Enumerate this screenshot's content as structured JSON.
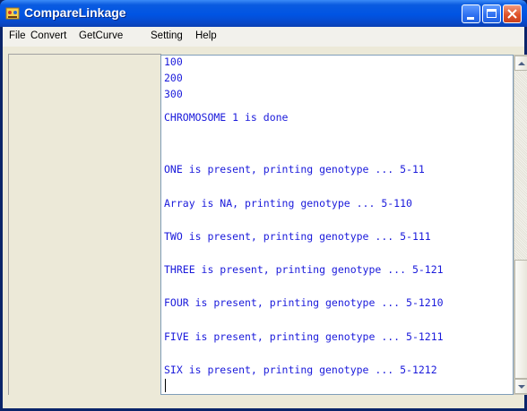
{
  "window": {
    "title": "CompareLinkage"
  },
  "menu": [
    "File",
    "Convert",
    "GetCurve",
    "Setting",
    "Help"
  ],
  "output": {
    "lines": [
      "100",
      "200",
      "300",
      "CHROMOSOME 1 is done",
      "ONE is present, printing genotype ... 5-11",
      "Array is NA, printing genotype ... 5-110",
      "TWO is present, printing genotype ... 5-111",
      "THREE is present, printing genotype ... 5-121",
      "FOUR is present, printing genotype ... 5-1210",
      "FIVE is present, printing genotype ... 5-1211",
      "SIX is present, printing genotype ... 5-1212"
    ]
  },
  "colors": {
    "text": "#1a1adb",
    "titlebar": "#0054e3",
    "close": "#e0532a"
  },
  "icons": {
    "app": "app-icon",
    "minimize": "minimize-icon",
    "maximize": "maximize-icon",
    "close": "close-icon"
  }
}
